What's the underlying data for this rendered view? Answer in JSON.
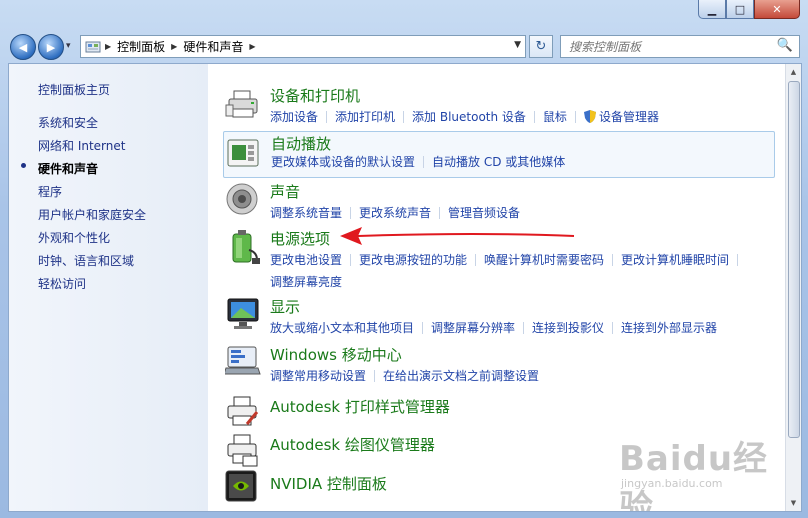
{
  "window": {
    "minimize_glyph": "▁",
    "maximize_glyph": "□",
    "close_glyph": "✕"
  },
  "nav": {
    "back_glyph": "◀",
    "forward_glyph": "▶",
    "history_glyph": "▾",
    "breadcrumb": [
      "控制面板",
      "硬件和声音"
    ],
    "breadcrumb_sep": "▶",
    "address_dropdown_glyph": "▼",
    "refresh_glyph": "↻",
    "search_placeholder": "搜索控制面板",
    "search_glyph": "🔍"
  },
  "sidebar": {
    "items": [
      {
        "label": "控制面板主页",
        "current": false
      },
      {
        "label": "系统和安全",
        "current": false
      },
      {
        "label": "网络和 Internet",
        "current": false
      },
      {
        "label": "硬件和声音",
        "current": true
      },
      {
        "label": "程序",
        "current": false
      },
      {
        "label": "用户帐户和家庭安全",
        "current": false
      },
      {
        "label": "外观和个性化",
        "current": false
      },
      {
        "label": "时钟、语言和区域",
        "current": false
      },
      {
        "label": "轻松访问",
        "current": false
      }
    ]
  },
  "categories": [
    {
      "title": "设备和打印机",
      "icon": "printer-devices-icon",
      "links": [
        "添加设备",
        "添加打印机",
        "添加 Bluetooth 设备",
        "鼠标",
        "设备管理器"
      ]
    },
    {
      "title": "自动播放",
      "icon": "autoplay-icon",
      "links": [
        "更改媒体或设备的默认设置",
        "自动播放 CD 或其他媒体"
      ]
    },
    {
      "title": "声音",
      "icon": "speaker-icon",
      "links": [
        "调整系统音量",
        "更改系统声音",
        "管理音频设备"
      ]
    },
    {
      "title": "电源选项",
      "icon": "battery-plug-icon",
      "links": [
        "更改电池设置",
        "更改电源按钮的功能",
        "唤醒计算机时需要密码",
        "更改计算机睡眠时间",
        "调整屏幕亮度"
      ]
    },
    {
      "title": "显示",
      "icon": "monitor-icon",
      "links": [
        "放大或缩小文本和其他项目",
        "调整屏幕分辨率",
        "连接到投影仪",
        "连接到外部显示器"
      ]
    },
    {
      "title": "Windows 移动中心",
      "icon": "mobility-center-icon",
      "links": [
        "调整常用移动设置",
        "在给出演示文档之前调整设置"
      ]
    },
    {
      "title": "Autodesk 打印样式管理器",
      "icon": "plot-style-printer-icon",
      "links": []
    },
    {
      "title": "Autodesk 绘图仪管理器",
      "icon": "plotter-manager-icon",
      "links": []
    },
    {
      "title": "NVIDIA 控制面板",
      "icon": "nvidia-icon",
      "links": []
    }
  ],
  "watermark": {
    "brand": "Baidu经验",
    "url": "jingyan.baidu.com"
  },
  "colors": {
    "link": "#2144a8",
    "category_title": "#1a7a1a",
    "annotation_arrow": "#e0191f"
  }
}
